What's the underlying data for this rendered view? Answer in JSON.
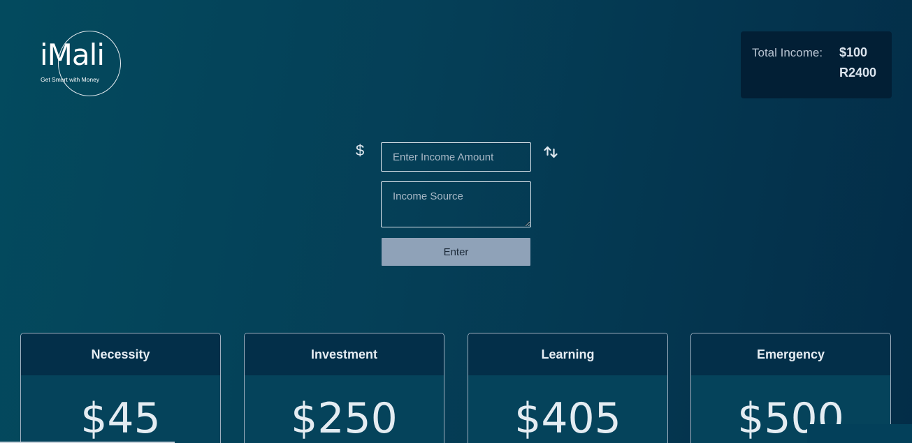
{
  "logo": {
    "name": "iMali",
    "tagline": "Get Smart with Money"
  },
  "total_income": {
    "label": "Total Income:",
    "usd": "$100",
    "zar": "R2400"
  },
  "form": {
    "currency_symbol": "$",
    "amount_placeholder": "Enter Income Amount",
    "source_placeholder": "Income Source",
    "enter_label": "Enter",
    "swap_icon": "swap-vertical-icon"
  },
  "categories": [
    {
      "title": "Necessity",
      "amount": "$45"
    },
    {
      "title": "Investment",
      "amount": "$250"
    },
    {
      "title": "Learning",
      "amount": "$405"
    },
    {
      "title": "Emergency",
      "amount": "$500"
    }
  ],
  "colors": {
    "background_start": "#034a5e",
    "background_end": "#032d48",
    "card_header": "#032f49",
    "income_card": "#021f35",
    "button": "#8fa2b8"
  }
}
